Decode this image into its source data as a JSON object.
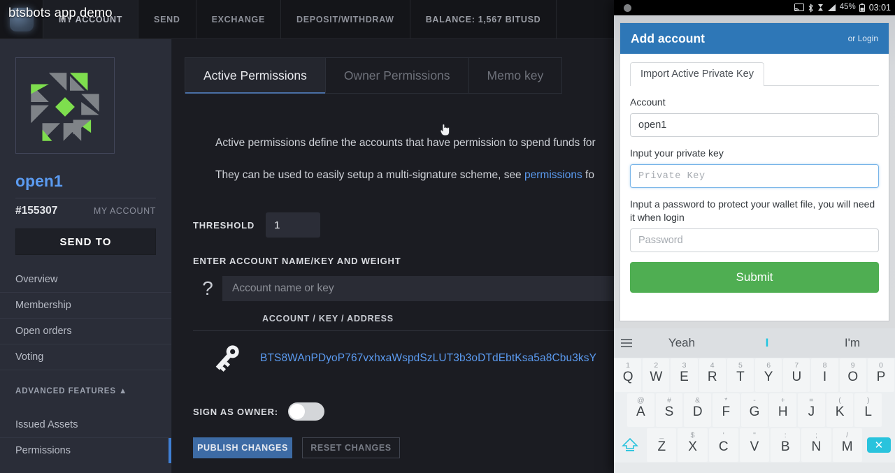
{
  "overlay_caption": "btsbots app demo",
  "topnav": {
    "items": [
      {
        "label": "MY ACCOUNT",
        "active": true
      },
      {
        "label": "SEND",
        "active": false
      },
      {
        "label": "EXCHANGE",
        "active": false
      },
      {
        "label": "DEPOSIT/WITHDRAW",
        "active": false
      },
      {
        "label": "BALANCE: 1,567 BITUSD",
        "active": false
      }
    ]
  },
  "sidebar": {
    "account_name": "open1",
    "account_id": "#155307",
    "my_account_label": "MY ACCOUNT",
    "send_to_label": "SEND TO",
    "items": [
      {
        "label": "Overview"
      },
      {
        "label": "Membership"
      },
      {
        "label": "Open orders"
      },
      {
        "label": "Voting"
      }
    ],
    "advanced_header": "ADVANCED FEATURES ▲",
    "advanced_items": [
      {
        "label": "Issued Assets"
      },
      {
        "label": "Permissions"
      }
    ]
  },
  "main": {
    "tabs": [
      {
        "label": "Active Permissions",
        "active": true
      },
      {
        "label": "Owner Permissions",
        "active": false
      },
      {
        "label": "Memo key",
        "active": false
      }
    ],
    "paragraph1": "Active permissions define the accounts that have permission to spend funds for",
    "paragraph2_before": "They can be used to easily setup a multi-signature scheme, see ",
    "paragraph2_link": "permissions",
    "paragraph2_after": " fo",
    "threshold_label": "THRESHOLD",
    "threshold_value": "1",
    "enter_label": "ENTER ACCOUNT NAME/KEY AND WEIGHT",
    "account_input_placeholder": "Account name or key",
    "help_icon": "?",
    "column_header": "ACCOUNT / KEY / ADDRESS",
    "key_value": "BTS8WAnPDyoP767vxhxaWspdSzLUT3b3oDTdEbtKsa5a8Cbu3ksY",
    "sign_as_owner_label": "SIGN AS OWNER:",
    "sign_as_owner_on": false,
    "publish_label": "PUBLISH CHANGES",
    "reset_label": "RESET CHANGES",
    "link_color": "#5b9bf1"
  },
  "phone": {
    "statusbar": {
      "battery_percent": "45%",
      "time": "03:01",
      "icons": [
        "cast-icon",
        "bluetooth-icon",
        "hourglass-icon",
        "signal-icon",
        "battery-icon",
        "clock-icon",
        "share-icon"
      ]
    },
    "modal": {
      "title": "Add account",
      "login_link": "or Login",
      "tab_label": "Import Active Private Key",
      "account_label": "Account",
      "account_value": "open1",
      "private_key_label": "Input your private key",
      "private_key_placeholder": "Private Key",
      "password_label": "Input a password to protect your wallet file, you will need it when login",
      "password_placeholder": "Password",
      "submit_label": "Submit",
      "header_color": "#2e77b7",
      "submit_color": "#4fae52"
    },
    "keyboard": {
      "suggestions": [
        {
          "text": "Yeah",
          "selected": false
        },
        {
          "text": "I",
          "selected": true
        },
        {
          "text": "I'm",
          "selected": false
        }
      ],
      "row1": [
        {
          "key": "Q",
          "sup": "1"
        },
        {
          "key": "W",
          "sup": "2"
        },
        {
          "key": "E",
          "sup": "3"
        },
        {
          "key": "R",
          "sup": "4"
        },
        {
          "key": "T",
          "sup": "5"
        },
        {
          "key": "Y",
          "sup": "6"
        },
        {
          "key": "U",
          "sup": "7"
        },
        {
          "key": "I",
          "sup": "8"
        },
        {
          "key": "O",
          "sup": "9"
        },
        {
          "key": "P",
          "sup": "0"
        }
      ],
      "row2": [
        {
          "key": "A",
          "sup": "@"
        },
        {
          "key": "S",
          "sup": "#"
        },
        {
          "key": "D",
          "sup": "&"
        },
        {
          "key": "F",
          "sup": "*"
        },
        {
          "key": "G",
          "sup": "-"
        },
        {
          "key": "H",
          "sup": "+"
        },
        {
          "key": "J",
          "sup": "="
        },
        {
          "key": "K",
          "sup": "("
        },
        {
          "key": "L",
          "sup": ")"
        }
      ],
      "row3": [
        {
          "key": "Z",
          "sup": "_"
        },
        {
          "key": "X",
          "sup": "$"
        },
        {
          "key": "C",
          "sup": "'"
        },
        {
          "key": "V",
          "sup": "\""
        },
        {
          "key": "B",
          "sup": ":"
        },
        {
          "key": "N",
          "sup": ";"
        },
        {
          "key": "M",
          "sup": "/"
        }
      ],
      "shift_icon": "shift-icon",
      "backspace_icon": "backspace-icon",
      "accent_color": "#29c3dd"
    }
  }
}
